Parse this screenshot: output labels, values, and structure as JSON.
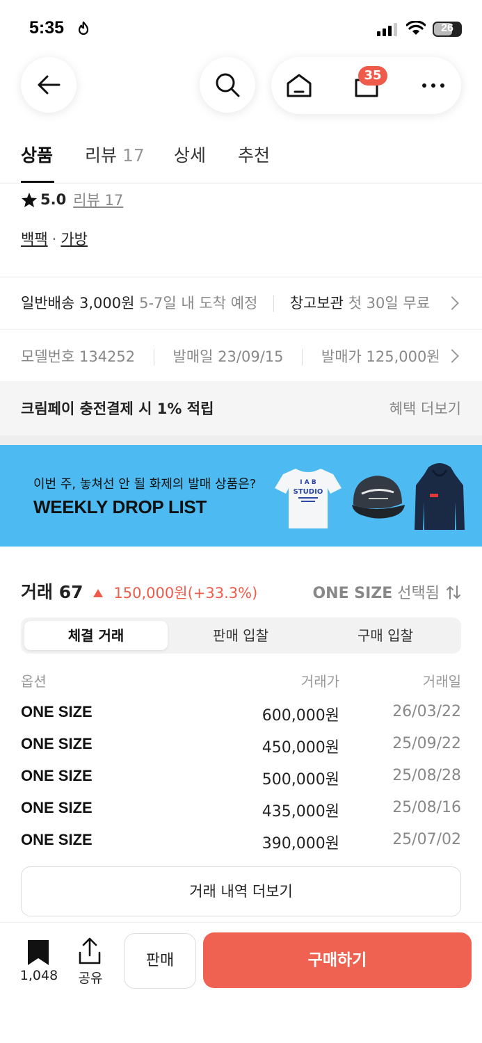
{
  "status_bar": {
    "time": "5:35",
    "battery": "26"
  },
  "nav": {
    "cart_badge": "35"
  },
  "tabs": [
    {
      "label": "상품",
      "count": ""
    },
    {
      "label": "리뷰",
      "count": "17"
    },
    {
      "label": "상세",
      "count": ""
    },
    {
      "label": "추천",
      "count": ""
    }
  ],
  "rating": {
    "value": "5.0",
    "review_text": "리뷰 17"
  },
  "breadcrumb": {
    "cat1": "백팩",
    "sep": "·",
    "cat2": "가방"
  },
  "shipping": {
    "label": "일반배송 3,000원",
    "eta": "5-7일 내 도착 예정",
    "storage_label": "창고보관",
    "storage_desc": "첫 30일 무료"
  },
  "product_info": {
    "model_label": "모델번호",
    "model_value": "134252",
    "release_label": "발매일",
    "release_value": "23/09/15",
    "price_label": "발매가",
    "price_value": "125,000원"
  },
  "benefit": {
    "text": "크림페이 충전결제 시 1% 적립",
    "more": "혜택 더보기"
  },
  "banner": {
    "subtitle": "이번 주, 놓쳐선 안 될 화제의 발매 상품은?",
    "title": "WEEKLY DROP LIST",
    "tshirt_print": "STUDIO"
  },
  "trade": {
    "label": "거래 67",
    "change": "150,000원(+33.3%)",
    "size": "ONE SIZE",
    "size_suffix": "선택됨",
    "segments": [
      "체결 거래",
      "판매 입찰",
      "구매 입찰"
    ],
    "headers": {
      "option": "옵션",
      "price": "거래가",
      "date": "거래일"
    },
    "rows": [
      {
        "option": "ONE SIZE",
        "price": "600,000원",
        "date": "26/03/22"
      },
      {
        "option": "ONE SIZE",
        "price": "450,000원",
        "date": "25/09/22"
      },
      {
        "option": "ONE SIZE",
        "price": "500,000원",
        "date": "25/08/28"
      },
      {
        "option": "ONE SIZE",
        "price": "435,000원",
        "date": "25/08/16"
      },
      {
        "option": "ONE SIZE",
        "price": "390,000원",
        "date": "25/07/02"
      }
    ],
    "more_button": "거래 내역 더보기"
  },
  "bottom_bar": {
    "bookmark_count": "1,048",
    "share_label": "공유",
    "sell_label": "판매",
    "buy_label": "구매하기"
  },
  "colors": {
    "accent": "#ef6150",
    "banner_bg": "#4dbbf2",
    "price_up": "#ef5b4a"
  },
  "icons": [
    "back-arrow-icon",
    "search-icon",
    "home-icon",
    "cart-icon",
    "more-icon",
    "star-icon",
    "chevron-right-icon",
    "sort-icon",
    "bookmark-icon",
    "share-icon"
  ]
}
